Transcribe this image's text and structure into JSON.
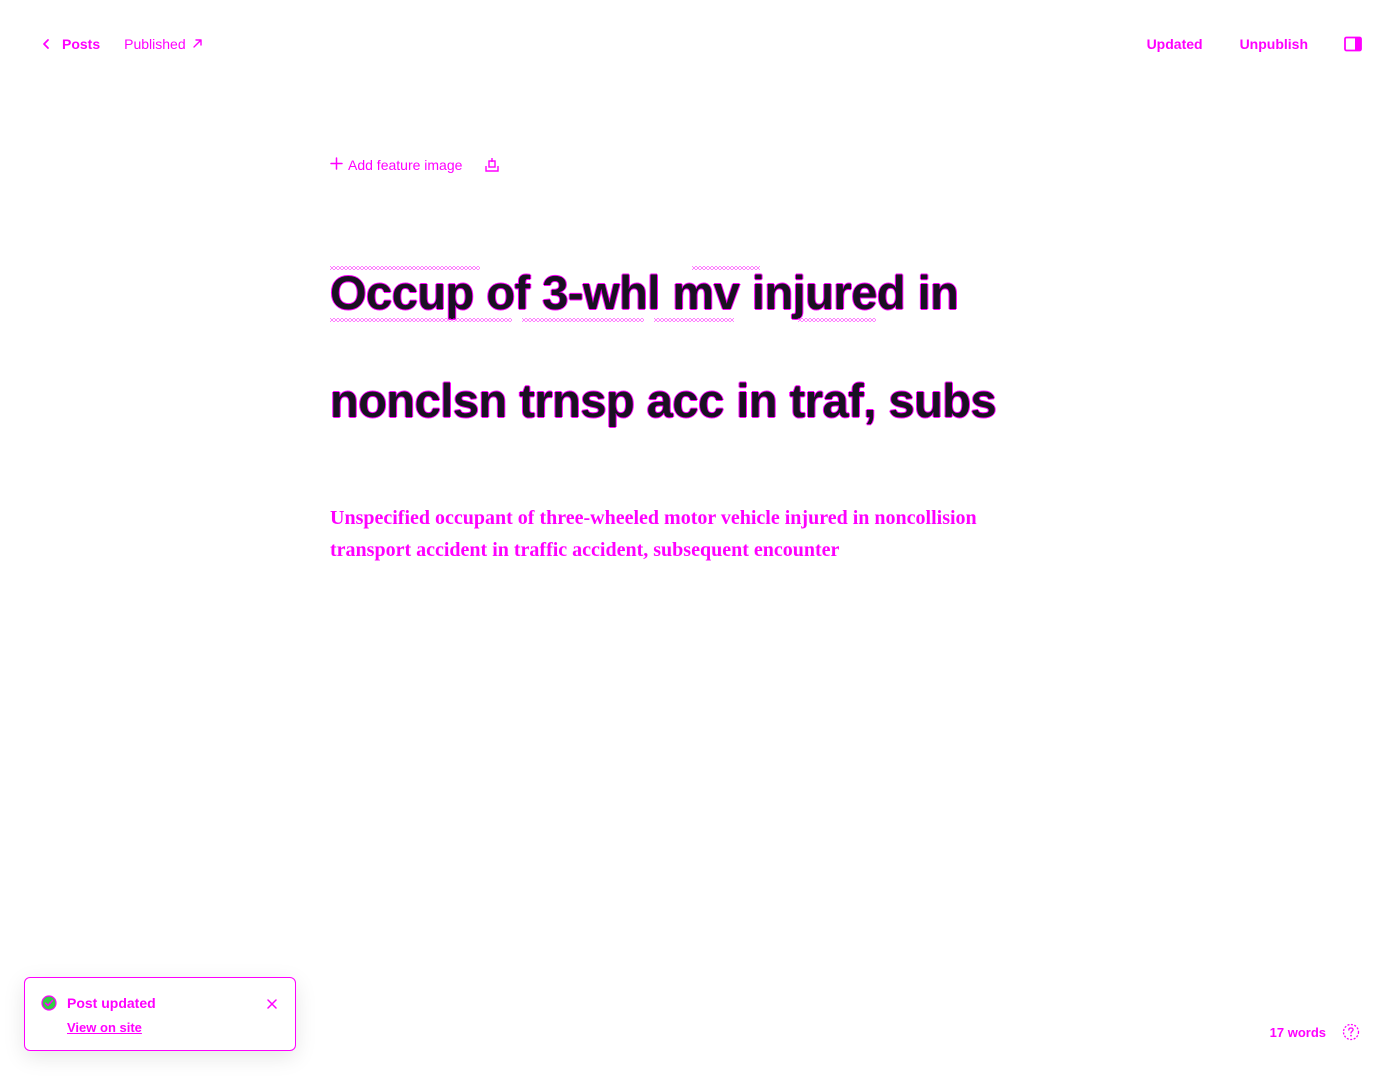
{
  "topbar": {
    "back_label": "Posts",
    "status_label": "Published",
    "updated_label": "Updated",
    "unpublish_label": "Unpublish"
  },
  "editor": {
    "add_feature_image_label": "Add feature image",
    "title_line_1": "Occup of 3-whl mv injured in",
    "title_line_2": "nonclsn trnsp acc in traf, subs",
    "excerpt": "Unspecified occupant of three-wheeled motor vehicle injured in noncollision transport accident in traffic accident, subsequent encounter"
  },
  "toast": {
    "title": "Post updated",
    "link_label": "View on site"
  },
  "footer": {
    "word_count": "17 words"
  },
  "icons": {
    "back": "chevron-left-icon",
    "external": "arrow-up-right-icon",
    "sidebar": "sidebar-panel-icon",
    "add": "plus-icon",
    "unsplash": "image-upload-icon",
    "check": "check-circle-icon",
    "close": "close-icon",
    "help": "question-circle-icon"
  },
  "colors": {
    "accent": "#ff00ff",
    "title_text": "#1a1222",
    "check_fill": "#30cf43",
    "background": "#ffffff"
  }
}
